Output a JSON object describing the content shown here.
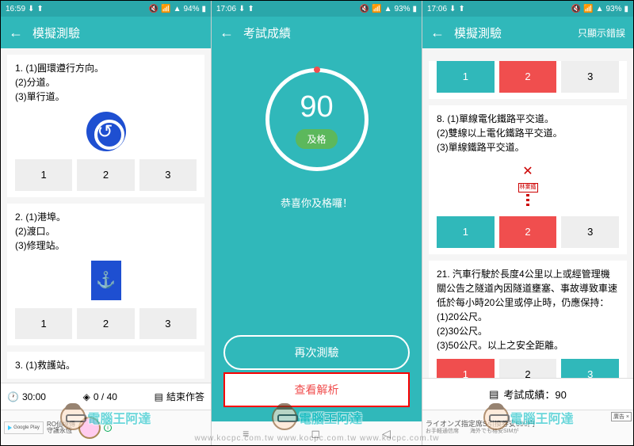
{
  "status": {
    "time_left": "16:59",
    "time_mid": "17:06",
    "time_right": "17:06",
    "battery_left": "94%",
    "battery_mid": "93%",
    "battery_right": "93%"
  },
  "screen1": {
    "title": "模擬測驗",
    "q1": {
      "text": "1. (1)圓環遵行方向。\n(2)分道。\n(3)單行道。",
      "opts": [
        "1",
        "2",
        "3"
      ]
    },
    "q2": {
      "text": "2. (1)港埠。\n(2)渡口。\n(3)修理站。",
      "opts": [
        "1",
        "2",
        "3"
      ]
    },
    "q3_prefix": "3. (1)救護站。",
    "bottom": {
      "timer": "30:00",
      "progress": "0 / 40",
      "end": "結束作答"
    },
    "ad": {
      "gp": "Google Play",
      "line1": "RO仙境傳",
      "line2": "守護永恆"
    }
  },
  "screen2": {
    "title": "考試成績",
    "score": "90",
    "pass": "及格",
    "congrats": "恭喜你及格囉！",
    "retry": "再次測驗",
    "analysis": "查看解析"
  },
  "screen3": {
    "title": "模擬測驗",
    "header_right": "只顯示錯誤",
    "top_opts": [
      "1",
      "2",
      "3"
    ],
    "q8": {
      "text": "8. (1)單線電化鐵路平交道。\n(2)雙線以上電化鐵路平交道。\n(3)單線鐵路平交道。",
      "opts": [
        "1",
        "2",
        "3"
      ],
      "rail_label": "林業鐵"
    },
    "q21": {
      "text": "21. 汽車行駛於長度4公里以上或經管理機關公告之隧道內因隧道壅塞、事故導致車速低於每小時20公里或停止時，仍應保持：\n(1)20公尺。\n(2)30公尺。\n(3)50公尺。以上之安全距離。",
      "opts": [
        "1",
        "2",
        "3"
      ]
    },
    "bottom_score": "考試成績：90",
    "ad": {
      "line1": "ライオンズ指定席S引換券安690円",
      "line2": "お手軽通信席　　海外でも格安SIMが",
      "close": "廣告 ×"
    }
  },
  "watermark": {
    "text": "電腦王阿達",
    "url": "www.kocpc.com.tw    www.kocpc.com.tw    www.kocpc.com.tw"
  }
}
